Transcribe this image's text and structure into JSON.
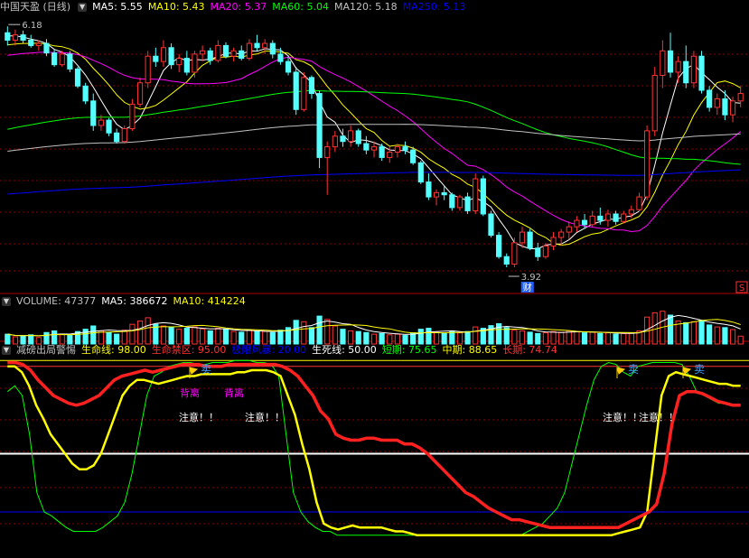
{
  "colors": {
    "bg": "#000000",
    "up": "#ff3232",
    "down": "#54ffff",
    "grid": "#8b0000",
    "divider": "#b00000"
  },
  "price_panel": {
    "title": "中国天盈 (日线)",
    "ma_labels": [
      {
        "text": "MA5: 5.55",
        "color": "#ffffff"
      },
      {
        "text": "MA10: 5.43",
        "color": "#ffff00"
      },
      {
        "text": "MA20: 5.37",
        "color": "#ff00ff"
      },
      {
        "text": "MA60: 5.04",
        "color": "#00ff00"
      },
      {
        "text": "MA120: 5.18",
        "color": "#c0c0c0"
      },
      {
        "text": "MA250: 5.13",
        "color": "#0000ff"
      }
    ],
    "high_label": "6.18",
    "low_label": "3.92",
    "event_marker": "财",
    "side_marker": "S"
  },
  "volume_panel": {
    "labels": [
      {
        "text": "VOLUME: 47377",
        "color": "#c0c0c0"
      },
      {
        "text": "MA5: 386672",
        "color": "#ffffff"
      },
      {
        "text": "MA10: 414224",
        "color": "#ffff00"
      }
    ]
  },
  "indicator_panel": {
    "labels": [
      {
        "text": "减磅出局警惕",
        "color": "#c0c0c0"
      },
      {
        "text": "生命线: 98.00",
        "color": "#ffff00"
      },
      {
        "text": "生命禁区: 95.00",
        "color": "#ff3232"
      },
      {
        "text": "极限风暴: 20.00",
        "color": "#0000ff"
      },
      {
        "text": "生死线: 50.00",
        "color": "#ffffff"
      },
      {
        "text": "短期: 75.65",
        "color": "#00ff00"
      },
      {
        "text": "中期: 88.65",
        "color": "#ffff00"
      },
      {
        "text": "长期: 74.74",
        "color": "#ff3232"
      }
    ],
    "sell_label": "卖",
    "divergence_label": "背离",
    "attention_label": "注意！！"
  },
  "chart_data": [
    {
      "type": "candlestick",
      "title": "中国天盈 (日线)",
      "ylim": [
        3.7,
        6.3
      ],
      "annotations": {
        "high": 6.18,
        "low": 3.92
      },
      "candles": [
        [
          6.12,
          6.18,
          6.0,
          6.05
        ],
        [
          6.05,
          6.15,
          6.0,
          6.1
        ],
        [
          6.1,
          6.14,
          6.02,
          6.05
        ],
        [
          6.05,
          6.1,
          5.98,
          6.0
        ],
        [
          6.0,
          6.05,
          5.95,
          6.02
        ],
        [
          6.02,
          6.06,
          5.9,
          5.93
        ],
        [
          5.93,
          5.96,
          5.8,
          5.82
        ],
        [
          5.82,
          5.95,
          5.8,
          5.92
        ],
        [
          5.92,
          5.95,
          5.75,
          5.78
        ],
        [
          5.78,
          5.8,
          5.6,
          5.62
        ],
        [
          5.62,
          5.65,
          5.45,
          5.48
        ],
        [
          5.48,
          5.55,
          5.2,
          5.25
        ],
        [
          5.25,
          5.35,
          5.2,
          5.3
        ],
        [
          5.3,
          5.32,
          5.15,
          5.18
        ],
        [
          5.18,
          5.22,
          5.08,
          5.1
        ],
        [
          5.1,
          5.25,
          5.08,
          5.22
        ],
        [
          5.22,
          5.5,
          5.2,
          5.45
        ],
        [
          5.45,
          5.7,
          5.42,
          5.65
        ],
        [
          5.65,
          5.95,
          5.6,
          5.9
        ],
        [
          5.9,
          5.98,
          5.8,
          5.85
        ],
        [
          5.85,
          6.05,
          5.8,
          5.98
        ],
        [
          5.98,
          6.02,
          5.78,
          5.82
        ],
        [
          5.82,
          5.92,
          5.75,
          5.88
        ],
        [
          5.88,
          5.95,
          5.72,
          5.75
        ],
        [
          5.75,
          5.95,
          5.7,
          5.92
        ],
        [
          5.92,
          6.0,
          5.85,
          5.95
        ],
        [
          5.95,
          5.98,
          5.82,
          5.86
        ],
        [
          5.86,
          6.05,
          5.84,
          6.0
        ],
        [
          6.0,
          6.03,
          5.88,
          5.9
        ],
        [
          5.9,
          5.98,
          5.85,
          5.95
        ],
        [
          5.95,
          6.0,
          5.86,
          5.88
        ],
        [
          5.88,
          6.06,
          5.86,
          6.02
        ],
        [
          6.02,
          6.1,
          5.95,
          5.98
        ],
        [
          5.98,
          6.06,
          5.92,
          6.02
        ],
        [
          6.02,
          6.05,
          5.88,
          5.92
        ],
        [
          5.92,
          5.98,
          5.82,
          5.85
        ],
        [
          5.85,
          5.9,
          5.72,
          5.75
        ],
        [
          5.75,
          5.8,
          5.35,
          5.4
        ],
        [
          5.4,
          5.75,
          5.38,
          5.7
        ],
        [
          5.7,
          5.72,
          5.5,
          5.55
        ],
        [
          5.55,
          5.58,
          4.85,
          4.95
        ],
        [
          4.95,
          5.1,
          4.6,
          5.05
        ],
        [
          5.05,
          5.2,
          5.0,
          5.15
        ],
        [
          5.15,
          5.22,
          5.05,
          5.1
        ],
        [
          5.1,
          5.25,
          5.05,
          5.2
        ],
        [
          5.2,
          5.22,
          5.05,
          5.08
        ],
        [
          5.08,
          5.15,
          4.98,
          5.02
        ],
        [
          5.02,
          5.1,
          4.95,
          5.05
        ],
        [
          5.05,
          5.08,
          4.92,
          4.95
        ],
        [
          4.95,
          5.05,
          4.9,
          5.0
        ],
        [
          5.0,
          5.08,
          4.95,
          5.05
        ],
        [
          5.05,
          5.1,
          4.98,
          5.02
        ],
        [
          5.02,
          5.05,
          4.88,
          4.9
        ],
        [
          4.9,
          4.92,
          4.7,
          4.72
        ],
        [
          4.72,
          4.8,
          4.55,
          4.58
        ],
        [
          4.58,
          4.65,
          4.5,
          4.62
        ],
        [
          4.62,
          4.68,
          4.55,
          4.6
        ],
        [
          4.6,
          4.62,
          4.45,
          4.48
        ],
        [
          4.48,
          4.6,
          4.45,
          4.58
        ],
        [
          4.58,
          4.62,
          4.42,
          4.45
        ],
        [
          4.45,
          4.8,
          4.42,
          4.75
        ],
        [
          4.75,
          4.78,
          4.4,
          4.42
        ],
        [
          4.42,
          4.45,
          4.2,
          4.22
        ],
        [
          4.22,
          4.25,
          4.0,
          4.02
        ],
        [
          4.02,
          4.05,
          3.92,
          3.95
        ],
        [
          3.95,
          4.2,
          3.92,
          4.15
        ],
        [
          4.15,
          4.3,
          4.1,
          4.25
        ],
        [
          4.25,
          4.28,
          4.08,
          4.1
        ],
        [
          4.1,
          4.15,
          3.98,
          4.02
        ],
        [
          4.02,
          4.15,
          4.0,
          4.12
        ],
        [
          4.12,
          4.25,
          4.08,
          4.2
        ],
        [
          4.2,
          4.28,
          4.12,
          4.25
        ],
        [
          4.25,
          4.35,
          4.18,
          4.3
        ],
        [
          4.3,
          4.4,
          4.25,
          4.36
        ],
        [
          4.36,
          4.42,
          4.28,
          4.32
        ],
        [
          4.32,
          4.45,
          4.3,
          4.4
        ],
        [
          4.4,
          4.48,
          4.32,
          4.36
        ],
        [
          4.36,
          4.46,
          4.3,
          4.42
        ],
        [
          4.42,
          4.45,
          4.32,
          4.35
        ],
        [
          4.35,
          4.45,
          4.33,
          4.42
        ],
        [
          4.42,
          4.5,
          4.38,
          4.46
        ],
        [
          4.46,
          4.62,
          4.44,
          4.58
        ],
        [
          4.58,
          5.25,
          4.55,
          5.2
        ],
        [
          5.2,
          5.8,
          5.15,
          5.72
        ],
        [
          5.72,
          6.05,
          5.6,
          5.95
        ],
        [
          5.95,
          6.12,
          5.7,
          5.75
        ],
        [
          5.75,
          5.9,
          5.65,
          5.85
        ],
        [
          5.85,
          6.0,
          5.6,
          5.65
        ],
        [
          5.65,
          5.95,
          5.6,
          5.9
        ],
        [
          5.9,
          5.95,
          5.55,
          5.58
        ],
        [
          5.58,
          5.62,
          5.38,
          5.42
        ],
        [
          5.42,
          5.55,
          5.35,
          5.5
        ],
        [
          5.5,
          5.58,
          5.3,
          5.35
        ],
        [
          5.35,
          5.52,
          5.28,
          5.48
        ],
        [
          5.48,
          5.62,
          5.42,
          5.55
        ]
      ]
    },
    {
      "type": "bar",
      "series": [
        {
          "name": "VOLUME",
          "values": [
            30,
            22,
            25,
            28,
            20,
            35,
            40,
            30,
            26,
            38,
            45,
            55,
            40,
            35,
            30,
            42,
            60,
            70,
            80,
            60,
            55,
            50,
            45,
            48,
            52,
            46,
            40,
            48,
            44,
            38,
            36,
            42,
            40,
            38,
            35,
            42,
            50,
            72,
            68,
            50,
            85,
            75,
            55,
            45,
            40,
            38,
            35,
            30,
            32,
            28,
            30,
            26,
            34,
            45,
            48,
            36,
            32,
            40,
            34,
            38,
            52,
            48,
            56,
            62,
            50,
            42,
            40,
            36,
            32,
            34,
            38,
            36,
            40,
            38,
            34,
            36,
            32,
            34,
            30,
            32,
            34,
            40,
            82,
            95,
            100,
            88,
            70,
            65,
            68,
            72,
            58,
            52,
            50,
            44,
            24
          ]
        }
      ]
    },
    {
      "type": "line",
      "ylim": [
        0,
        100
      ],
      "series": [
        {
          "name": "短期",
          "values": [
            82,
            85,
            80,
            60,
            30,
            20,
            18,
            15,
            12,
            10,
            10,
            10,
            10,
            12,
            15,
            18,
            25,
            40,
            60,
            80,
            90,
            92,
            95,
            96,
            97,
            97,
            96,
            96,
            97,
            97,
            97,
            98,
            98,
            98,
            97,
            97,
            96,
            90,
            60,
            30,
            20,
            15,
            12,
            10,
            10,
            8,
            8,
            8,
            8,
            8,
            8,
            8,
            8,
            8,
            8,
            8,
            8,
            8,
            8,
            8,
            8,
            8,
            8,
            8,
            8,
            8,
            8,
            8,
            8,
            8,
            8,
            10,
            12,
            14,
            18,
            22,
            30,
            45,
            60,
            75,
            88,
            95,
            97,
            96,
            92,
            90,
            95,
            96,
            97,
            97,
            97,
            97,
            96,
            90,
            82,
            80,
            78,
            76,
            76,
            75,
            75
          ]
        },
        {
          "name": "中期",
          "values": [
            95,
            95,
            92,
            85,
            75,
            68,
            60,
            55,
            50,
            45,
            42,
            42,
            44,
            50,
            60,
            70,
            80,
            85,
            88,
            88,
            87,
            86,
            87,
            88,
            89,
            90,
            90,
            91,
            91,
            91,
            91,
            91,
            92,
            92,
            93,
            93,
            93,
            92,
            90,
            80,
            70,
            55,
            42,
            25,
            14,
            12,
            11,
            12,
            13,
            12,
            12,
            12,
            12,
            11,
            10,
            10,
            9,
            8,
            8,
            8,
            8,
            8,
            8,
            8,
            8,
            8,
            8,
            8,
            8,
            8,
            8,
            8,
            8,
            8,
            8,
            8,
            8,
            8,
            8,
            8,
            8,
            8,
            8,
            8,
            8,
            9,
            10,
            11,
            12,
            20,
            50,
            80,
            90,
            92,
            91,
            90,
            89,
            88,
            87,
            86,
            86,
            85,
            85
          ]
        },
        {
          "name": "长期",
          "values": [
            97,
            97,
            96,
            93,
            88,
            84,
            80,
            78,
            76,
            75,
            76,
            78,
            80,
            84,
            88,
            90,
            91,
            92,
            93,
            92,
            93,
            94,
            95,
            96,
            96,
            96,
            95,
            95,
            95,
            96,
            96,
            96,
            96,
            96,
            96,
            96,
            95,
            93,
            90,
            85,
            80,
            72,
            68,
            60,
            58,
            57,
            57,
            58,
            58,
            57,
            57,
            57,
            55,
            55,
            53,
            50,
            46,
            42,
            38,
            34,
            30,
            28,
            25,
            22,
            20,
            18,
            16,
            16,
            15,
            14,
            13,
            12,
            12,
            12,
            12,
            12,
            12,
            12,
            12,
            12,
            12,
            14,
            16,
            18,
            20,
            24,
            40,
            65,
            80,
            82,
            82,
            81,
            79,
            77,
            76,
            75,
            75
          ]
        }
      ],
      "reference_lines": [
        {
          "name": "生命线",
          "value": 98.0
        },
        {
          "name": "生命禁区",
          "value": 95.0
        },
        {
          "name": "生死线",
          "value": 50.0
        },
        {
          "name": "极限风暴",
          "value": 20.0
        }
      ]
    }
  ]
}
